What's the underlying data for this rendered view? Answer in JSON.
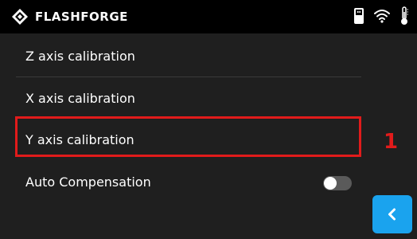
{
  "header": {
    "brand": "FLASHFORGE",
    "icons": [
      "flashforge-logo-icon",
      "usb-drive-icon",
      "wifi-icon",
      "thermometer-icon"
    ]
  },
  "menu": {
    "items": [
      {
        "label": "Z axis calibration"
      },
      {
        "label": "X axis calibration"
      },
      {
        "label": "Y axis calibration"
      },
      {
        "label": "Auto Compensation"
      }
    ]
  },
  "auto_compensation": {
    "enabled": false
  },
  "annotation": {
    "number": "1",
    "color": "#e11b1b"
  },
  "back_button": {
    "icon": "chevron-left-icon",
    "color": "#1aa3ee"
  }
}
